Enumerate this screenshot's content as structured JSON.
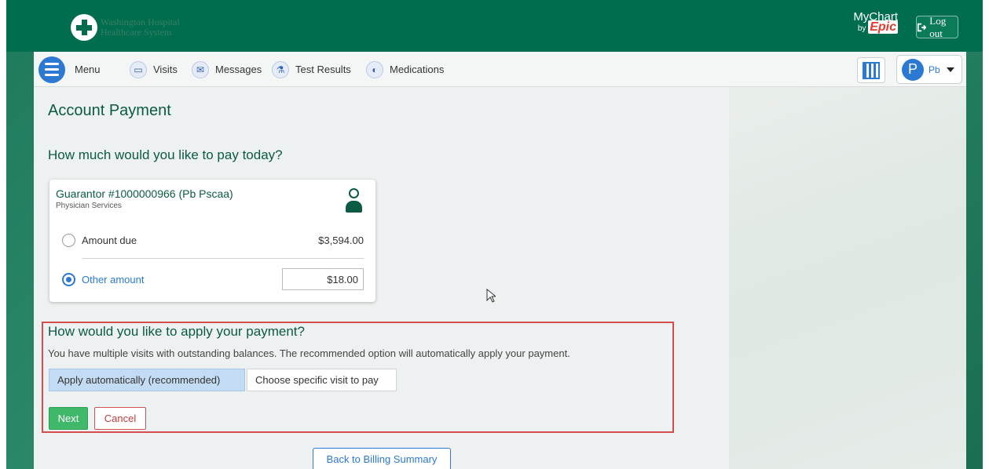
{
  "header": {
    "org_name_line1": "Washington Hospital",
    "org_name_line2": "Healthcare System",
    "brand_line1": "MyChart",
    "brand_by": "by",
    "brand_epic": "Epic",
    "logout_label": "Log out"
  },
  "nav": {
    "menu_label": "Menu",
    "items": [
      {
        "label": "Visits",
        "icon": "calendar-icon"
      },
      {
        "label": "Messages",
        "icon": "envelope-icon"
      },
      {
        "label": "Test Results",
        "icon": "flask-icon"
      },
      {
        "label": "Medications",
        "icon": "pill-icon"
      }
    ],
    "user_initial": "P",
    "user_name": "Pb"
  },
  "page": {
    "title": "Account Payment",
    "question": "How much would you like to pay today?"
  },
  "guarantor": {
    "title": "Guarantor #1000000966 (Pb Pscaa)",
    "subtitle": "Physician Services",
    "amount_due_label": "Amount due",
    "amount_due_value": "$3,594.00",
    "other_amount_label": "Other amount",
    "other_amount_value": "$18.00",
    "selected": "other_amount"
  },
  "apply": {
    "title": "How would you like to apply your payment?",
    "description": "You have multiple visits with outstanding balances. The recommended option will automatically apply your payment.",
    "option_auto": "Apply automatically (recommended)",
    "option_specific": "Choose specific visit to pay",
    "selected": "auto"
  },
  "actions": {
    "next": "Next",
    "cancel": "Cancel",
    "back": "Back to Billing Summary"
  },
  "colors": {
    "header_green": "#006d4e",
    "accent_blue": "#2b79d3",
    "heading_green": "#0b5a44",
    "highlight_red": "#d64d4d",
    "next_green": "#3fb86a"
  }
}
